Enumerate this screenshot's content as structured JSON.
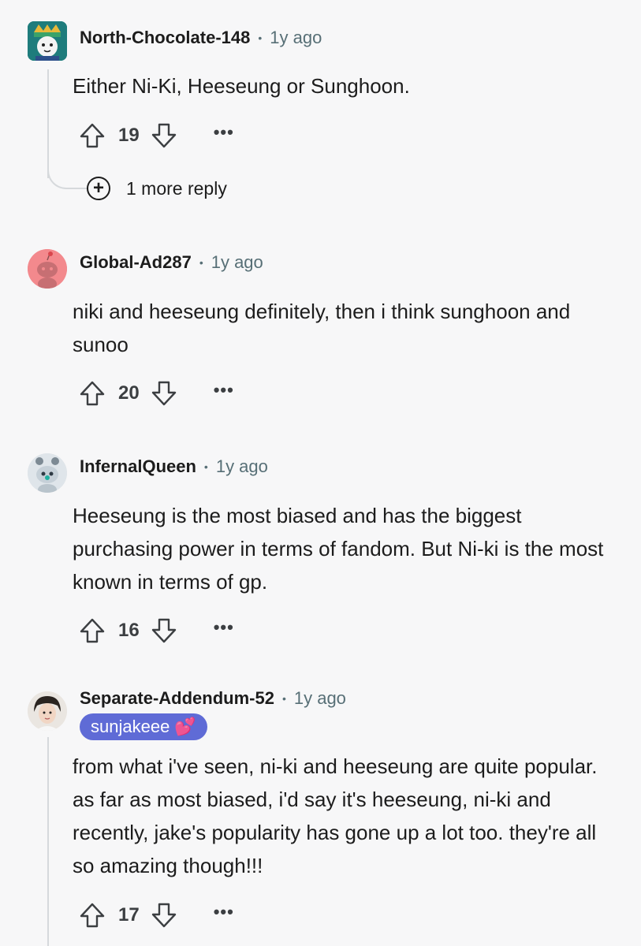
{
  "comments": [
    {
      "author": "North-Chocolate-148",
      "time": "1y ago",
      "body": "Either Ni-Ki, Heeseung or Sunghoon.",
      "votes": "19",
      "more_replies": "1 more reply"
    },
    {
      "author": "Global-Ad287",
      "time": "1y ago",
      "body": "niki and heeseung definitely, then i think sunghoon and sunoo",
      "votes": "20"
    },
    {
      "author": "InfernalQueen",
      "time": "1y ago",
      "body": "Heeseung is the most biased and has the biggest purchasing power in terms of fandom. But Ni-ki is the most known in terms of gp.",
      "votes": "16"
    },
    {
      "author": "Separate-Addendum-52",
      "time": "1y ago",
      "flair": "sunjakeee 💕",
      "body": "from what i've seen, ni-ki and heeseung are quite popular. as far as most biased, i'd say it's heeseung, ni-ki and recently, jake's popularity has gone up a lot too. they're all so amazing though!!!",
      "votes": "17"
    }
  ],
  "separator": "•",
  "more_label": "•••",
  "icons": {
    "upvote": "upvote-arrow-icon",
    "downvote": "downvote-arrow-icon",
    "more": "overflow-menu-icon",
    "expand": "plus-circle-icon"
  },
  "colors": {
    "background": "#f7f7f8",
    "meta_text": "#576f76",
    "flair_bg": "#5f6bd6",
    "thread_line": "#d6d9dc"
  }
}
